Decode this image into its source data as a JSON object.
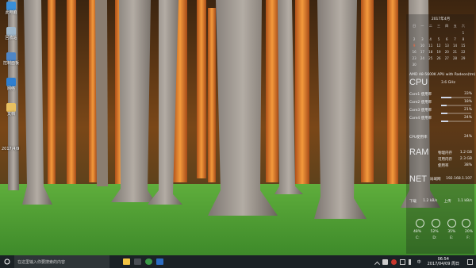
{
  "desktop": {
    "icons": [
      {
        "label": "此电脑",
        "icon": "computer-icon",
        "color": "#3a8fd8"
      },
      {
        "label": "回收站",
        "icon": "recycle-bin-icon",
        "color": "#9fb6c8"
      },
      {
        "label": "控制面板",
        "icon": "control-panel-icon",
        "color": "#4f86c6"
      },
      {
        "label": "网络",
        "icon": "network-icon",
        "color": "#2f7fd0"
      },
      {
        "label": "文档",
        "icon": "folder-icon",
        "color": "#e8c060"
      }
    ],
    "side_date": "2017/4/9"
  },
  "widgets": {
    "calendar": {
      "title": "2017年4月",
      "weekdays": [
        "日",
        "一",
        "二",
        "三",
        "四",
        "五",
        "六"
      ],
      "days": [
        "",
        "",
        "",
        "",
        "",
        "",
        "1",
        "2",
        "3",
        "4",
        "5",
        "6",
        "7",
        "8",
        "9",
        "10",
        "11",
        "12",
        "13",
        "14",
        "15",
        "16",
        "17",
        "18",
        "19",
        "20",
        "21",
        "22",
        "23",
        "24",
        "25",
        "26",
        "27",
        "28",
        "29",
        "30"
      ],
      "today": "9"
    },
    "cpu": {
      "model": "AMD A8-5600K APU with Radeon(tm)",
      "label": "CPU",
      "freq": "3.6 GHz",
      "cores": [
        {
          "name": "Core1 使用率",
          "value": "33%",
          "level": 0.33
        },
        {
          "name": "Core2 使用率",
          "value": "18%",
          "level": 0.18
        },
        {
          "name": "Core3 使用率",
          "value": "21%",
          "level": 0.21
        },
        {
          "name": "Core4 使用率",
          "value": "24%",
          "level": 0.24
        }
      ],
      "usage_label": "CPU使用率",
      "usage": "24%"
    },
    "ram": {
      "label": "RAM",
      "rows": [
        {
          "name": "物理内存",
          "value": "1.2 GB"
        },
        {
          "name": "可用内存",
          "value": "2.3 GB"
        },
        {
          "name": "使用率",
          "value": "38%"
        }
      ]
    },
    "net": {
      "label": "NET",
      "ip_label": "局域网",
      "ip": "192.168.1.107",
      "down_label": "下载",
      "down": "1.2 kB/s",
      "up_label": "上传",
      "up": "1.1 kB/s"
    },
    "gauges": [
      {
        "label": "C:",
        "value": "48%",
        "level": 0.48
      },
      {
        "label": "D:",
        "value": "52%",
        "level": 0.52
      },
      {
        "label": "E:",
        "value": "35%",
        "level": 0.35
      },
      {
        "label": "F:",
        "value": "20%",
        "level": 0.2
      }
    ]
  },
  "taskbar": {
    "search_placeholder": "在这里输入你要搜索的内容",
    "apps": [
      {
        "name": "file-explorer",
        "color": "#f3c443"
      },
      {
        "name": "calculator",
        "color": "#4a4f55"
      },
      {
        "name": "app-green",
        "color": "#3c9b48"
      },
      {
        "name": "word",
        "color": "#2b6cc2"
      }
    ],
    "time": "06:54",
    "date": "2017/04/09 周日"
  }
}
